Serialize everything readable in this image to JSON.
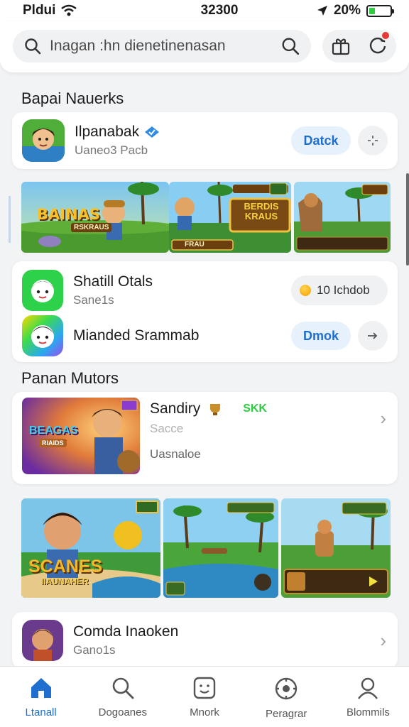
{
  "status_bar": {
    "carrier": "Pldui",
    "time": "32300",
    "battery": "20%"
  },
  "header": {
    "search_placeholder": "Inagan :hn dienetinenasan"
  },
  "section1": {
    "title": "Bapai Nauerks"
  },
  "featured_app": {
    "name": "Ilpanabak",
    "sub": "Uaneo3 Pacb",
    "button": "Datck"
  },
  "banner_row": {
    "b1_text": "BAINAS",
    "b1_sub": "RSKRAUS",
    "b2_text": "BERDIS\nKRAUS",
    "b2_btn": "FRAU"
  },
  "list_apps": [
    {
      "name": "Shatill Otals",
      "sub": "Sane1s",
      "price": "10 Ichdob"
    },
    {
      "name": "Mianded Srammab",
      "button": "Dmok"
    }
  ],
  "section2": {
    "title": "Panan Mutors"
  },
  "promo_card": {
    "name": "Sandiry",
    "tag": "SKK",
    "sub": "Sacce",
    "desc": "Uasnaloe",
    "art_text": "BEAGAS",
    "art_sub": "RIAIDS"
  },
  "gallery": {
    "g1_text": "SCANES",
    "g1_sub": "IIAUNAHER"
  },
  "bottom_card": {
    "name": "Comda Inaoken",
    "sub": "Gano1s"
  },
  "nav": [
    {
      "label": "Ltanall",
      "active": true
    },
    {
      "label": "Dogoanes"
    },
    {
      "label": "Mnork"
    },
    {
      "label": "Peragrar"
    },
    {
      "label": "Blommils"
    }
  ],
  "colors": {
    "accent": "#1e6fd0",
    "badge": "#e53935",
    "battery": "#2ecc40"
  }
}
